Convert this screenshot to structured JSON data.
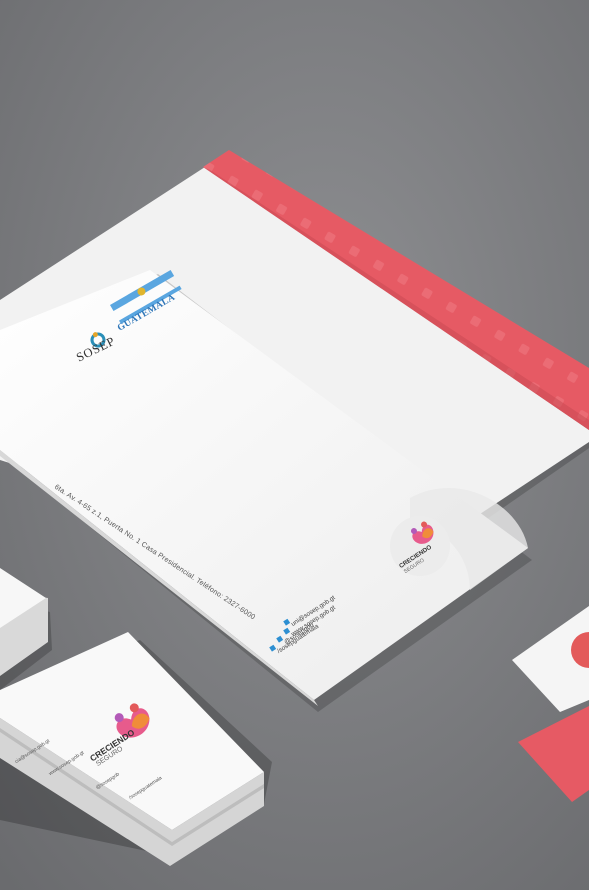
{
  "letterhead": {
    "address": "6ta. Av. 4-65 z.1, Puerta No. 1 Casa Presidencial. Teléfono: 2327-6000",
    "brand_name": "SOSEP",
    "government_logo_text": "GUATEMALA",
    "contacts": [
      "uni@sosep.gob.gt",
      "www.sosep.gob.gt",
      "@sosepgob",
      "/sosepguatemala"
    ],
    "campaign_logo_title": "CRECIENDO",
    "campaign_logo_subtitle": "SEGURO"
  },
  "business_card": {
    "logo_title": "CRECIENDO",
    "logo_subtitle": "SEGURO",
    "contacts": [
      "cia@sosep.gob.gt",
      "www.sosep.gob.gt",
      "@sosepgob",
      "/sosepguatemala"
    ]
  },
  "colors": {
    "background": "#7a7b7e",
    "envelope_lining": "#e65a64",
    "paper": "#f4f4f4",
    "gov_blue": "#2f76b8"
  }
}
